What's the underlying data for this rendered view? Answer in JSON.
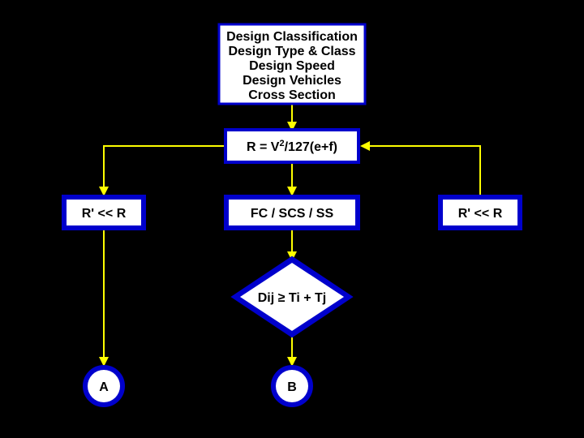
{
  "top_box": {
    "line1": "Design Classification",
    "line2": "Design Type & Class",
    "line3": "Design Speed",
    "line4": "Design Vehicles",
    "line5": "Cross Section"
  },
  "formula_box": {
    "pre": "R = V",
    "sup": "2",
    "post": "/127(e+f)"
  },
  "left_box": "R' << R",
  "center_box": "FC / SCS / SS",
  "right_box": "R' << R",
  "decision": {
    "pre": "Dij ",
    "sym": "≥",
    "post": " Ti + Tj"
  },
  "circle_a": "A",
  "circle_b": "B"
}
